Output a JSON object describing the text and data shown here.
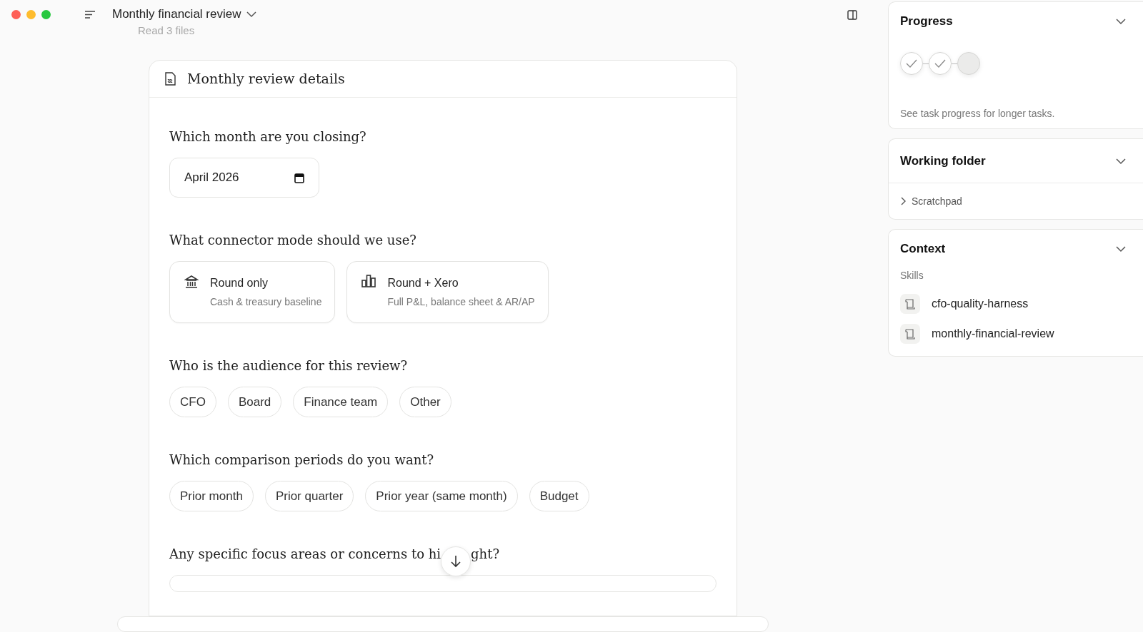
{
  "titlebar": {
    "title": "Monthly financial review",
    "faded_note": "Read 3 files"
  },
  "form": {
    "title": "Monthly review details",
    "questions": [
      {
        "kind": "month",
        "label": "Which month are you closing?",
        "value": "April 2026"
      },
      {
        "kind": "cards",
        "label": "What connector mode should we use?",
        "options": [
          {
            "title": "Round only",
            "subtitle": "Cash & treasury baseline",
            "selected": false
          },
          {
            "title": "Round + Xero",
            "subtitle": "Full P&L, balance sheet & AR/AP",
            "selected": false
          }
        ]
      },
      {
        "kind": "pills",
        "label": "Who is the audience for this review?",
        "options": [
          {
            "label": "CFO",
            "selected": false
          },
          {
            "label": "Board",
            "selected": false
          },
          {
            "label": "Finance team",
            "selected": false
          },
          {
            "label": "Other",
            "selected": false
          }
        ]
      },
      {
        "kind": "pills",
        "label": "Which comparison periods do you want?",
        "options": [
          {
            "label": "Prior month",
            "selected": false
          },
          {
            "label": "Prior quarter",
            "selected": false
          },
          {
            "label": "Prior year (same month)",
            "selected": false
          },
          {
            "label": "Budget",
            "selected": false
          }
        ]
      },
      {
        "kind": "text",
        "label_parts": [
          "Any specific focus areas or concerns to hi",
          "ght?"
        ]
      }
    ]
  },
  "sidebar": {
    "progress": {
      "title": "Progress",
      "steps": [
        {
          "done": true
        },
        {
          "done": true
        },
        {
          "done": false
        }
      ],
      "note": "See task progress for longer tasks."
    },
    "working_folder": {
      "title": "Working folder",
      "items": [
        {
          "label": "Scratchpad",
          "expanded": false
        }
      ]
    },
    "context": {
      "title": "Context",
      "section": "Skills",
      "skills": [
        "cfo-quality-harness",
        "monthly-financial-review"
      ]
    }
  }
}
